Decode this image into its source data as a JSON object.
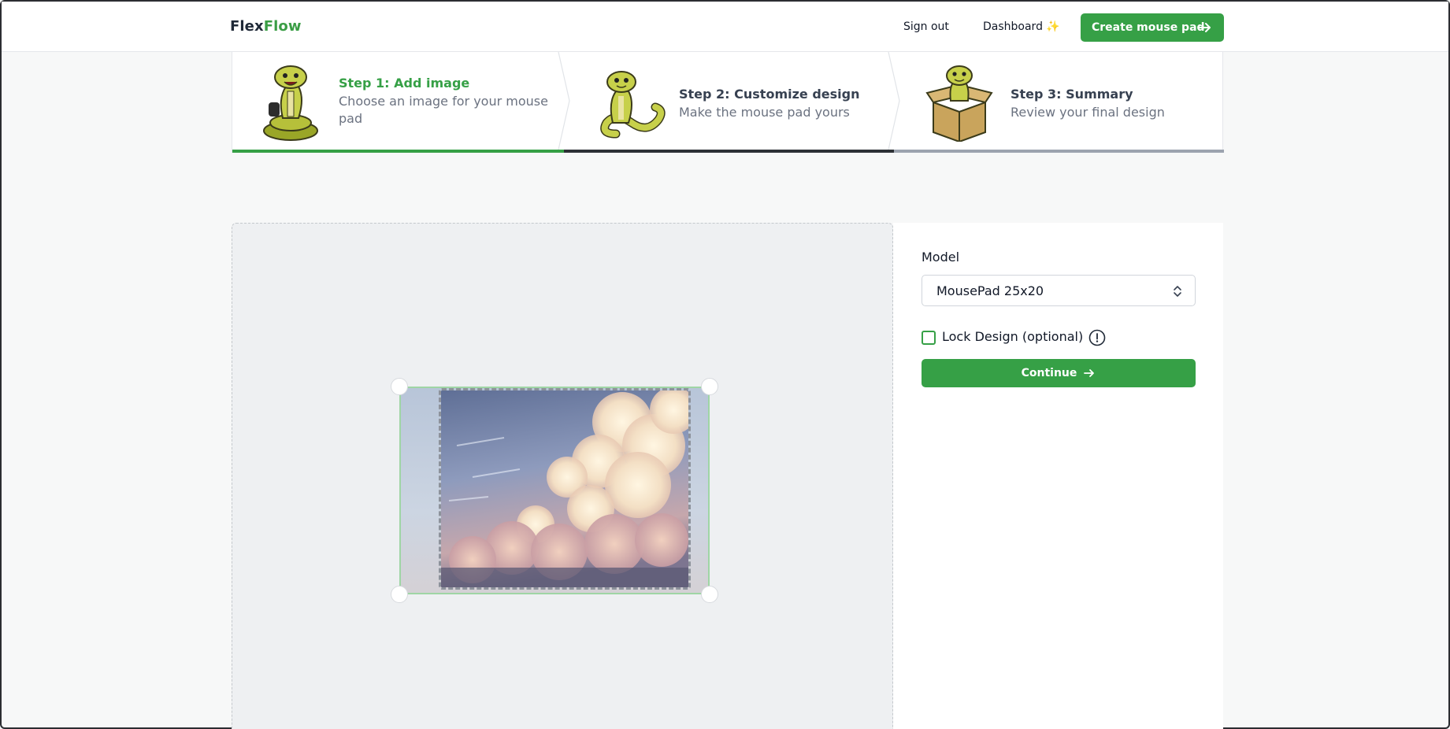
{
  "brand": {
    "name_part1": "Flex",
    "name_part2": "Flow",
    "accent_color": "#36a046"
  },
  "nav": {
    "sign_out": "Sign out",
    "dashboard": "Dashboard",
    "dashboard_icon": "sparkle-icon",
    "create_button": "Create mouse pad",
    "create_icon": "arrow-right-icon"
  },
  "steps": [
    {
      "title": "Step 1: Add image",
      "description": "Choose an image for your mouse pad",
      "state": "current"
    },
    {
      "title": "Step 2: Customize design",
      "description": "Make the mouse pad yours",
      "state": "upcoming"
    },
    {
      "title": "Step 3: Summary",
      "description": "Review your final design",
      "state": "upcoming"
    }
  ],
  "panel": {
    "model_label": "Model",
    "model_value": "MousePad 25x20",
    "lock_label": "Lock Design (optional)",
    "lock_checked": false,
    "info_icon": "info-icon",
    "continue_label": "Continue"
  }
}
